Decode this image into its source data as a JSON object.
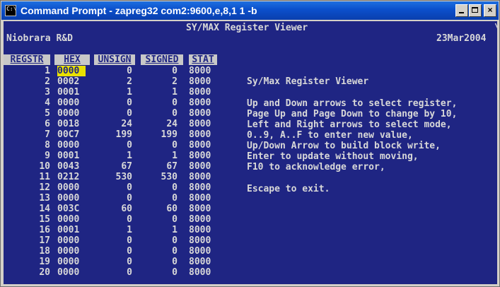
{
  "window": {
    "title": "Command Prompt - zapreg32 com2:9600,e,8,1 1 -b",
    "icon_text": "C:\\",
    "controls": {
      "minimize": "minimize-icon",
      "maximize": "maximize-icon",
      "close": "×"
    }
  },
  "header": {
    "title": "SY/MAX Register Viewer",
    "company": "Niobrara R&D",
    "date": "23Mar2004",
    "corner_mark": "\\"
  },
  "table": {
    "headers": [
      "REGSTR",
      "HEX",
      "UNSIGN",
      "SIGNED",
      "STAT"
    ],
    "selected_row": 0,
    "rows": [
      {
        "reg": "1",
        "hex": "0000",
        "unsign": "0",
        "signed": "0",
        "stat": "8000"
      },
      {
        "reg": "2",
        "hex": "0002",
        "unsign": "2",
        "signed": "2",
        "stat": "8000"
      },
      {
        "reg": "3",
        "hex": "0001",
        "unsign": "1",
        "signed": "1",
        "stat": "8000"
      },
      {
        "reg": "4",
        "hex": "0000",
        "unsign": "0",
        "signed": "0",
        "stat": "8000"
      },
      {
        "reg": "5",
        "hex": "0000",
        "unsign": "0",
        "signed": "0",
        "stat": "8000"
      },
      {
        "reg": "6",
        "hex": "0018",
        "unsign": "24",
        "signed": "24",
        "stat": "8000"
      },
      {
        "reg": "7",
        "hex": "00C7",
        "unsign": "199",
        "signed": "199",
        "stat": "8000"
      },
      {
        "reg": "8",
        "hex": "0000",
        "unsign": "0",
        "signed": "0",
        "stat": "8000"
      },
      {
        "reg": "9",
        "hex": "0001",
        "unsign": "1",
        "signed": "1",
        "stat": "8000"
      },
      {
        "reg": "10",
        "hex": "0043",
        "unsign": "67",
        "signed": "67",
        "stat": "8000"
      },
      {
        "reg": "11",
        "hex": "0212",
        "unsign": "530",
        "signed": "530",
        "stat": "8000"
      },
      {
        "reg": "12",
        "hex": "0000",
        "unsign": "0",
        "signed": "0",
        "stat": "8000"
      },
      {
        "reg": "13",
        "hex": "0000",
        "unsign": "0",
        "signed": "0",
        "stat": "8000"
      },
      {
        "reg": "14",
        "hex": "003C",
        "unsign": "60",
        "signed": "60",
        "stat": "8000"
      },
      {
        "reg": "15",
        "hex": "0000",
        "unsign": "0",
        "signed": "0",
        "stat": "8000"
      },
      {
        "reg": "16",
        "hex": "0001",
        "unsign": "1",
        "signed": "1",
        "stat": "8000"
      },
      {
        "reg": "17",
        "hex": "0000",
        "unsign": "0",
        "signed": "0",
        "stat": "8000"
      },
      {
        "reg": "18",
        "hex": "0000",
        "unsign": "0",
        "signed": "0",
        "stat": "8000"
      },
      {
        "reg": "19",
        "hex": "0000",
        "unsign": "0",
        "signed": "0",
        "stat": "8000"
      },
      {
        "reg": "20",
        "hex": "0000",
        "unsign": "0",
        "signed": "0",
        "stat": "8000"
      }
    ]
  },
  "help": {
    "title": "Sy/Max Register Viewer",
    "lines": [
      "Up and Down arrows to select register,",
      "Page Up and Page Down to change by 10,",
      "Left and Right arrows to select mode,",
      "0..9, A..F to enter new value,",
      "Up/Down Arrow to build block write,",
      "Enter to update without moving,",
      "F10 to acknowledge error,"
    ],
    "escape": "Escape to exit."
  },
  "colors": {
    "console_bg": "#1f2583",
    "console_text": "#d8d8d8",
    "selection_bg": "#e9e000",
    "titlebar": "#0b4fcb"
  }
}
